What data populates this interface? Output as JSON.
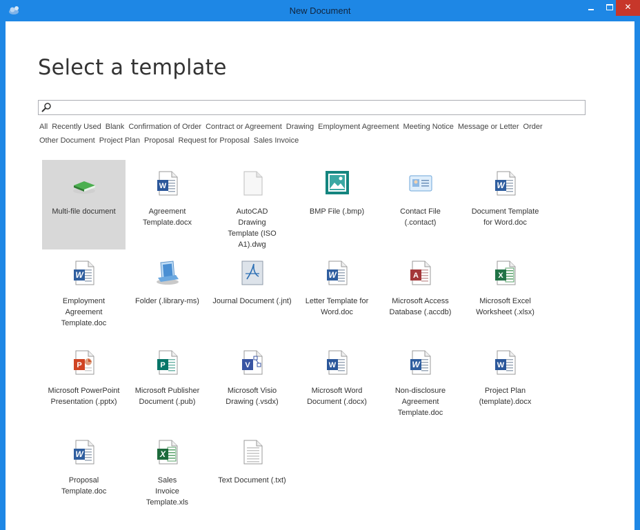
{
  "window": {
    "title": "New Document",
    "minimize_label": "–",
    "maximize_label": "□",
    "close_label": "✕"
  },
  "heading": "Select a template",
  "search": {
    "placeholder": ""
  },
  "filters": [
    "All",
    "Recently Used",
    "Blank",
    "Confirmation of Order",
    "Contract or Agreement",
    "Drawing",
    "Employment Agreement",
    "Meeting Notice",
    "Message or Letter",
    "Order",
    "Other Document",
    "Project Plan",
    "Proposal",
    "Request for Proposal",
    "Sales Invoice"
  ],
  "templates": [
    {
      "label": "Multi-file document",
      "icon": "green-book-icon",
      "selected": true
    },
    {
      "label": "Agreement Template.docx",
      "icon": "word-docx-icon"
    },
    {
      "label": "AutoCAD Drawing Template (ISO A1).dwg",
      "icon": "blank-file-icon"
    },
    {
      "label": "BMP File (.bmp)",
      "icon": "image-file-icon"
    },
    {
      "label": "Contact File (.contact)",
      "icon": "contact-card-icon"
    },
    {
      "label": "Document Template for Word.doc",
      "icon": "word-doc-icon"
    },
    {
      "label": "Employment Agreement Template.doc",
      "icon": "word-doc-icon"
    },
    {
      "label": "Folder (.library-ms)",
      "icon": "library-folder-icon"
    },
    {
      "label": "Journal Document (.jnt)",
      "icon": "journal-icon"
    },
    {
      "label": "Letter Template for Word.doc",
      "icon": "word-doc-icon"
    },
    {
      "label": "Microsoft Access Database (.accdb)",
      "icon": "access-icon"
    },
    {
      "label": "Microsoft Excel Worksheet (.xlsx)",
      "icon": "excel-icon"
    },
    {
      "label": "Microsoft PowerPoint Presentation (.pptx)",
      "icon": "powerpoint-icon"
    },
    {
      "label": "Microsoft Publisher Document (.pub)",
      "icon": "publisher-icon"
    },
    {
      "label": "Microsoft Visio Drawing (.vsdx)",
      "icon": "visio-icon"
    },
    {
      "label": "Microsoft Word Document (.docx)",
      "icon": "word-docx-icon"
    },
    {
      "label": "Non-disclosure Agreement Template.doc",
      "icon": "word-doc-icon"
    },
    {
      "label": "Project Plan (template).docx",
      "icon": "word-docx-icon"
    },
    {
      "label": "Proposal Template.doc",
      "icon": "word-doc-icon"
    },
    {
      "label": "Sales Invoice Template.xls",
      "icon": "excel-xls-icon"
    },
    {
      "label": "Text Document (.txt)",
      "icon": "text-file-icon"
    }
  ],
  "colors": {
    "titlebar": "#1e87e5",
    "close": "#c7372a",
    "selected_tile": "#d8d8d8"
  }
}
